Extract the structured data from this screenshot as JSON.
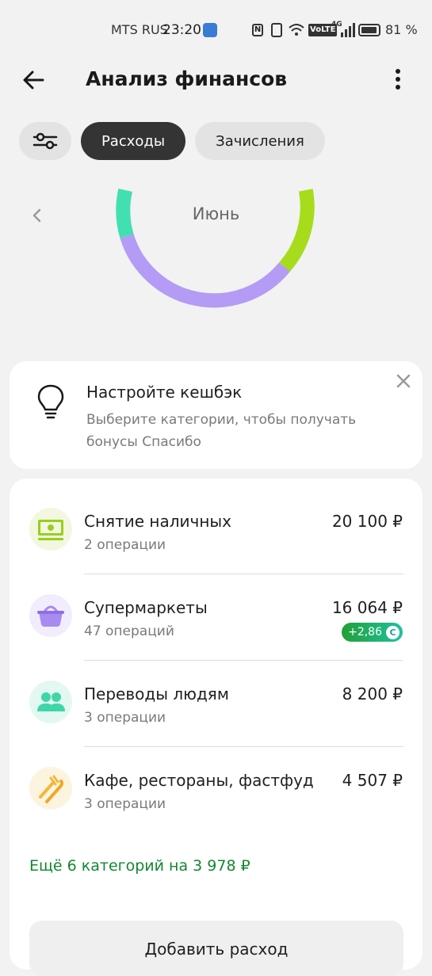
{
  "status_bar": {
    "carrier": "MTS RUS",
    "time": "23:20",
    "network": "4G",
    "volte": "VoLTE",
    "battery": "81 %"
  },
  "header": {
    "title": "Анализ финансов"
  },
  "tabs": [
    {
      "label": "Расходы",
      "active": true
    },
    {
      "label": "Зачисления",
      "active": false
    }
  ],
  "chart": {
    "month": "Июнь"
  },
  "cashback_card": {
    "title": "Настройте кешбэк",
    "subtitle": "Выберите категории, чтобы получать бонусы Спасибо"
  },
  "categories": [
    {
      "name": "Снятие наличных",
      "count": "2 операции",
      "amount": "20 100 ₽",
      "icon": "cash-icon",
      "color": "#9acd1e"
    },
    {
      "name": "Супермаркеты",
      "count": "47 операций",
      "amount": "16 064 ₽",
      "bonus": "+2,86",
      "icon": "basket-icon",
      "color": "#a78bf0"
    },
    {
      "name": "Переводы людям",
      "count": "3 операции",
      "amount": "8 200 ₽",
      "icon": "people-icon",
      "color": "#3ed6a8"
    },
    {
      "name": "Кафе, рестораны, фастфуд",
      "count": "3 операции",
      "amount": "4 507 ₽",
      "icon": "cutlery-icon",
      "color": "#f2b73c"
    }
  ],
  "more_link": "Ещё 6 категорий на 3 978 ₽",
  "add_button": "Добавить расход",
  "colors": {
    "accent_green": "#12882f",
    "chip_active": "#343434"
  }
}
